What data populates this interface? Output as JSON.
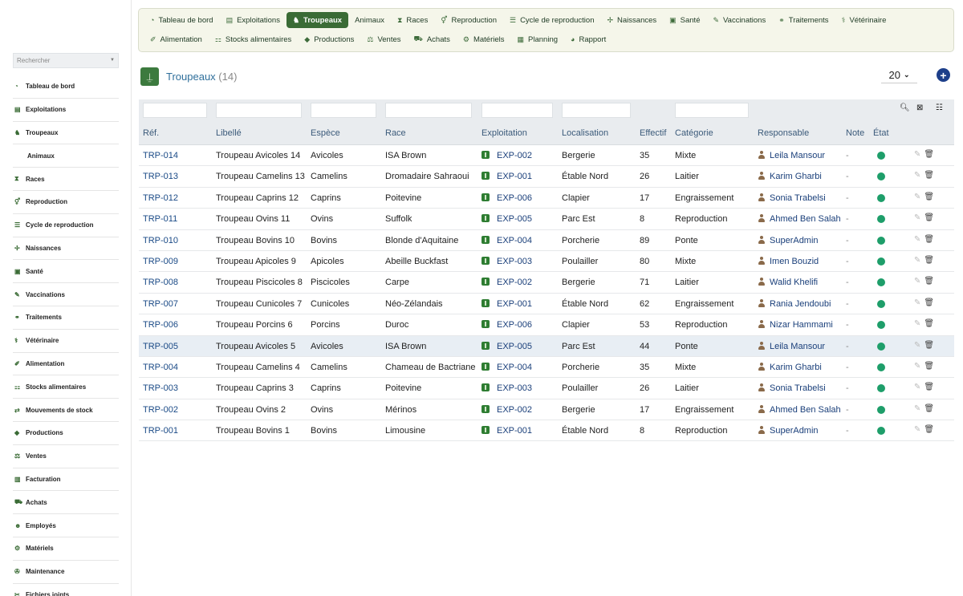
{
  "search": {
    "placeholder": "Rechercher"
  },
  "sidebar": {
    "items": [
      {
        "label": "Tableau de bord",
        "icon": "dashboard-icon",
        "glyph": "◔",
        "sub": false
      },
      {
        "label": "Exploitations",
        "icon": "barn-icon",
        "glyph": "▤",
        "sub": false
      },
      {
        "label": "Troupeaux",
        "icon": "herd-icon",
        "glyph": "♞",
        "sub": false
      },
      {
        "label": "Animaux",
        "icon": "",
        "glyph": "",
        "sub": true
      },
      {
        "label": "Races",
        "icon": "dna-icon",
        "glyph": "⧗",
        "sub": false
      },
      {
        "label": "Reproduction",
        "icon": "reproduction-icon",
        "glyph": "⚥",
        "sub": false
      },
      {
        "label": "Cycle de reproduction",
        "icon": "list-icon",
        "glyph": "☰",
        "sub": false
      },
      {
        "label": "Naissances",
        "icon": "baby-icon",
        "glyph": "✢",
        "sub": false
      },
      {
        "label": "Santé",
        "icon": "medkit-icon",
        "glyph": "▣",
        "sub": false
      },
      {
        "label": "Vaccinations",
        "icon": "syringe-icon",
        "glyph": "✎",
        "sub": false
      },
      {
        "label": "Traitements",
        "icon": "pills-icon",
        "glyph": "⚭",
        "sub": false
      },
      {
        "label": "Vétérinaire",
        "icon": "doctor-icon",
        "glyph": "⚕",
        "sub": false
      },
      {
        "label": "Alimentation",
        "icon": "feed-icon",
        "glyph": "✐",
        "sub": false
      },
      {
        "label": "Stocks alimentaires",
        "icon": "boxes-icon",
        "glyph": "⚏",
        "sub": false
      },
      {
        "label": "Mouvements de stock",
        "icon": "exchange-icon",
        "glyph": "⇄",
        "sub": false
      },
      {
        "label": "Productions",
        "icon": "drop-icon",
        "glyph": "◆",
        "sub": false
      },
      {
        "label": "Ventes",
        "icon": "sales-icon",
        "glyph": "⚖",
        "sub": false
      },
      {
        "label": "Facturation",
        "icon": "invoice-icon",
        "glyph": "▥",
        "sub": false
      },
      {
        "label": "Achats",
        "icon": "cart-icon",
        "glyph": "⛟",
        "sub": false
      },
      {
        "label": "Employés",
        "icon": "users-icon",
        "glyph": "☻",
        "sub": false
      },
      {
        "label": "Matériels",
        "icon": "tools-icon",
        "glyph": "⚙",
        "sub": false
      },
      {
        "label": "Maintenance",
        "icon": "wrench-icon",
        "glyph": "✇",
        "sub": false
      },
      {
        "label": "Fichiers joints",
        "icon": "paperclip-icon",
        "glyph": "✂",
        "sub": false
      }
    ]
  },
  "topnav": {
    "row1": [
      {
        "label": "Tableau de bord",
        "icon": "dashboard-icon",
        "glyph": "◔",
        "active": false
      },
      {
        "label": "Exploitations",
        "icon": "barn-icon",
        "glyph": "▤",
        "active": false
      },
      {
        "label": "Troupeaux",
        "icon": "herd-icon",
        "glyph": "♞",
        "active": true
      },
      {
        "label": "Animaux",
        "icon": "",
        "glyph": "",
        "active": false
      },
      {
        "label": "Races",
        "icon": "dna-icon",
        "glyph": "⧗",
        "active": false
      },
      {
        "label": "Reproduction",
        "icon": "reproduction-icon",
        "glyph": "⚥",
        "active": false
      },
      {
        "label": "Cycle de reproduction",
        "icon": "list-icon",
        "glyph": "☰",
        "active": false
      },
      {
        "label": "Naissances",
        "icon": "baby-icon",
        "glyph": "✢",
        "active": false
      },
      {
        "label": "Santé",
        "icon": "medkit-icon",
        "glyph": "▣",
        "active": false
      },
      {
        "label": "Vaccinations",
        "icon": "syringe-icon",
        "glyph": "✎",
        "active": false
      },
      {
        "label": "Traitements",
        "icon": "pills-icon",
        "glyph": "⚭",
        "active": false
      },
      {
        "label": "Vétérinaire",
        "icon": "doctor-icon",
        "glyph": "⚕",
        "active": false
      }
    ],
    "row2": [
      {
        "label": "Alimentation",
        "icon": "feed-icon",
        "glyph": "✐",
        "active": false
      },
      {
        "label": "Stocks alimentaires",
        "icon": "boxes-icon",
        "glyph": "⚏",
        "active": false
      },
      {
        "label": "Productions",
        "icon": "drop-icon",
        "glyph": "◆",
        "active": false
      },
      {
        "label": "Ventes",
        "icon": "sales-icon",
        "glyph": "⚖",
        "active": false
      },
      {
        "label": "Achats",
        "icon": "cart-icon",
        "glyph": "⛟",
        "active": false
      },
      {
        "label": "Matériels",
        "icon": "tools-icon",
        "glyph": "⚙",
        "active": false
      },
      {
        "label": "Planning",
        "icon": "calendar-icon",
        "glyph": "▦",
        "active": false
      },
      {
        "label": "Rapport",
        "icon": "chart-icon",
        "glyph": "◕",
        "active": false
      }
    ]
  },
  "header": {
    "title": "Troupeaux",
    "count": "(14)",
    "per_page": "20"
  },
  "table": {
    "columns": [
      "Réf.",
      "Libellé",
      "Espèce",
      "Race",
      "Exploitation",
      "Localisation",
      "Effectif",
      "Catégorie",
      "Responsable",
      "Note",
      "État"
    ],
    "rows": [
      {
        "ref": "TRP-014",
        "libelle": "Troupeau Avicoles 14",
        "espece": "Avicoles",
        "race": "ISA Brown",
        "exploitation": "EXP-002",
        "localisation": "Bergerie",
        "effectif": "35",
        "categorie": "Mixte",
        "responsable": "Leila Mansour",
        "note": "-"
      },
      {
        "ref": "TRP-013",
        "libelle": "Troupeau Camelins 13",
        "espece": "Camelins",
        "race": "Dromadaire Sahraoui",
        "exploitation": "EXP-001",
        "localisation": "Étable Nord",
        "effectif": "26",
        "categorie": "Laitier",
        "responsable": "Karim Gharbi",
        "note": "-"
      },
      {
        "ref": "TRP-012",
        "libelle": "Troupeau Caprins 12",
        "espece": "Caprins",
        "race": "Poitevine",
        "exploitation": "EXP-006",
        "localisation": "Clapier",
        "effectif": "17",
        "categorie": "Engraissement",
        "responsable": "Sonia Trabelsi",
        "note": "-"
      },
      {
        "ref": "TRP-011",
        "libelle": "Troupeau Ovins 11",
        "espece": "Ovins",
        "race": "Suffolk",
        "exploitation": "EXP-005",
        "localisation": "Parc Est",
        "effectif": "8",
        "categorie": "Reproduction",
        "responsable": "Ahmed Ben Salah",
        "note": "-"
      },
      {
        "ref": "TRP-010",
        "libelle": "Troupeau Bovins 10",
        "espece": "Bovins",
        "race": "Blonde d'Aquitaine",
        "exploitation": "EXP-004",
        "localisation": "Porcherie",
        "effectif": "89",
        "categorie": "Ponte",
        "responsable": "SuperAdmin",
        "note": "-"
      },
      {
        "ref": "TRP-009",
        "libelle": "Troupeau Apicoles 9",
        "espece": "Apicoles",
        "race": "Abeille Buckfast",
        "exploitation": "EXP-003",
        "localisation": "Poulailler",
        "effectif": "80",
        "categorie": "Mixte",
        "responsable": "Imen Bouzid",
        "note": "-"
      },
      {
        "ref": "TRP-008",
        "libelle": "Troupeau Piscicoles 8",
        "espece": "Piscicoles",
        "race": "Carpe",
        "exploitation": "EXP-002",
        "localisation": "Bergerie",
        "effectif": "71",
        "categorie": "Laitier",
        "responsable": "Walid Khelifi",
        "note": "-"
      },
      {
        "ref": "TRP-007",
        "libelle": "Troupeau Cunicoles 7",
        "espece": "Cunicoles",
        "race": "Néo-Zélandais",
        "exploitation": "EXP-001",
        "localisation": "Étable Nord",
        "effectif": "62",
        "categorie": "Engraissement",
        "responsable": "Rania Jendoubi",
        "note": "-"
      },
      {
        "ref": "TRP-006",
        "libelle": "Troupeau Porcins 6",
        "espece": "Porcins",
        "race": "Duroc",
        "exploitation": "EXP-006",
        "localisation": "Clapier",
        "effectif": "53",
        "categorie": "Reproduction",
        "responsable": "Nizar Hammami",
        "note": "-"
      },
      {
        "ref": "TRP-005",
        "libelle": "Troupeau Avicoles 5",
        "espece": "Avicoles",
        "race": "ISA Brown",
        "exploitation": "EXP-005",
        "localisation": "Parc Est",
        "effectif": "44",
        "categorie": "Ponte",
        "responsable": "Leila Mansour",
        "note": "-",
        "highlight": true
      },
      {
        "ref": "TRP-004",
        "libelle": "Troupeau Camelins 4",
        "espece": "Camelins",
        "race": "Chameau de Bactriane",
        "exploitation": "EXP-004",
        "localisation": "Porcherie",
        "effectif": "35",
        "categorie": "Mixte",
        "responsable": "Karim Gharbi",
        "note": "-"
      },
      {
        "ref": "TRP-003",
        "libelle": "Troupeau Caprins 3",
        "espece": "Caprins",
        "race": "Poitevine",
        "exploitation": "EXP-003",
        "localisation": "Poulailler",
        "effectif": "26",
        "categorie": "Laitier",
        "responsable": "Sonia Trabelsi",
        "note": "-"
      },
      {
        "ref": "TRP-002",
        "libelle": "Troupeau Ovins 2",
        "espece": "Ovins",
        "race": "Mérinos",
        "exploitation": "EXP-002",
        "localisation": "Bergerie",
        "effectif": "17",
        "categorie": "Engraissement",
        "responsable": "Ahmed Ben Salah",
        "note": "-"
      },
      {
        "ref": "TRP-001",
        "libelle": "Troupeau Bovins 1",
        "espece": "Bovins",
        "race": "Limousine",
        "exploitation": "EXP-001",
        "localisation": "Étable Nord",
        "effectif": "8",
        "categorie": "Reproduction",
        "responsable": "SuperAdmin",
        "note": "-"
      }
    ]
  },
  "colors": {
    "accent": "#3a6b35",
    "link": "#1a4a86",
    "state_active": "#1e9e6a",
    "add_button": "#1d3f8a"
  }
}
